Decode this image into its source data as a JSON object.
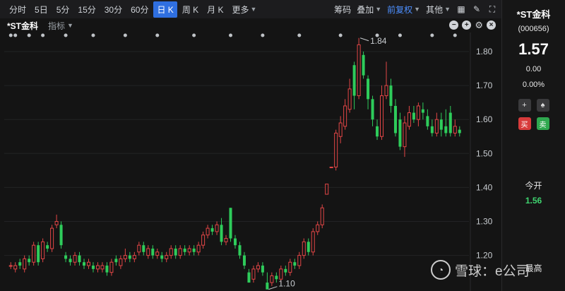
{
  "toolbar": {
    "periods": [
      "分时",
      "5日",
      "5分",
      "15分",
      "30分",
      "60分",
      "日 K",
      "周 K",
      "月 K",
      "更多"
    ],
    "active_period": "日 K",
    "right": {
      "chips": "筹码",
      "overlay": "叠加",
      "adjust": "前复权",
      "other": "其他"
    }
  },
  "chart_header": {
    "name": "*ST金科",
    "indicator": "指标"
  },
  "quote": {
    "name": "*ST金科",
    "code": "(000656)",
    "price": "1.57",
    "change": "0.00",
    "change_pct": "0.00%",
    "buy": "买",
    "sell": "卖",
    "open_label": "今开",
    "open_value": "1.56",
    "high_label": "最高"
  },
  "watermark": {
    "text": "雪球：e公司"
  },
  "colors": {
    "up": "#e24646",
    "down": "#2ecc5b",
    "active_tab": "#2f6fe0",
    "accent_text": "#4d8fff"
  },
  "chart_data": {
    "type": "candlestick",
    "y_ticks": [
      "1.80",
      "1.70",
      "1.60",
      "1.50",
      "1.40",
      "1.30",
      "1.20"
    ],
    "ylim": [
      1.1,
      1.84
    ],
    "max_label": "1.84",
    "min_label": "1.10",
    "candles": [
      [
        1.17,
        1.17,
        1.18,
        1.16
      ],
      [
        1.16,
        1.17,
        1.18,
        1.15
      ],
      [
        1.18,
        1.17,
        1.19,
        1.16
      ],
      [
        1.16,
        1.19,
        1.2,
        1.15
      ],
      [
        1.19,
        1.18,
        1.2,
        1.17
      ],
      [
        1.18,
        1.23,
        1.24,
        1.17
      ],
      [
        1.23,
        1.18,
        1.24,
        1.17
      ],
      [
        1.19,
        1.24,
        1.25,
        1.18
      ],
      [
        1.23,
        1.22,
        1.24,
        1.21
      ],
      [
        1.22,
        1.28,
        1.29,
        1.21
      ],
      [
        1.29,
        1.3,
        1.32,
        1.28
      ],
      [
        1.29,
        1.23,
        1.3,
        1.22
      ],
      [
        1.2,
        1.19,
        1.21,
        1.18
      ],
      [
        1.19,
        1.18,
        1.2,
        1.17
      ],
      [
        1.18,
        1.2,
        1.21,
        1.17
      ],
      [
        1.2,
        1.18,
        1.21,
        1.17
      ],
      [
        1.18,
        1.17,
        1.19,
        1.16
      ],
      [
        1.17,
        1.18,
        1.19,
        1.16
      ],
      [
        1.17,
        1.16,
        1.18,
        1.15
      ],
      [
        1.16,
        1.17,
        1.18,
        1.15
      ],
      [
        1.16,
        1.17,
        1.18,
        1.15
      ],
      [
        1.17,
        1.15,
        1.18,
        1.14
      ],
      [
        1.15,
        1.18,
        1.19,
        1.14
      ],
      [
        1.19,
        1.18,
        1.2,
        1.17
      ],
      [
        1.17,
        1.19,
        1.2,
        1.16
      ],
      [
        1.19,
        1.2,
        1.22,
        1.18
      ],
      [
        1.2,
        1.19,
        1.21,
        1.18
      ],
      [
        1.19,
        1.2,
        1.21,
        1.18
      ],
      [
        1.21,
        1.23,
        1.24,
        1.2
      ],
      [
        1.23,
        1.21,
        1.24,
        1.2
      ],
      [
        1.2,
        1.22,
        1.23,
        1.19
      ],
      [
        1.22,
        1.2,
        1.23,
        1.19
      ],
      [
        1.2,
        1.21,
        1.22,
        1.19
      ],
      [
        1.2,
        1.19,
        1.21,
        1.18
      ],
      [
        1.19,
        1.2,
        1.21,
        1.18
      ],
      [
        1.2,
        1.22,
        1.23,
        1.19
      ],
      [
        1.22,
        1.2,
        1.23,
        1.19
      ],
      [
        1.2,
        1.22,
        1.23,
        1.19
      ],
      [
        1.22,
        1.21,
        1.23,
        1.2
      ],
      [
        1.21,
        1.22,
        1.23,
        1.2
      ],
      [
        1.22,
        1.21,
        1.23,
        1.2
      ],
      [
        1.21,
        1.23,
        1.24,
        1.2
      ],
      [
        1.23,
        1.26,
        1.27,
        1.22
      ],
      [
        1.26,
        1.28,
        1.29,
        1.25
      ],
      [
        1.28,
        1.27,
        1.29,
        1.26
      ],
      [
        1.27,
        1.29,
        1.3,
        1.26
      ],
      [
        1.29,
        1.24,
        1.31,
        1.23
      ],
      [
        1.24,
        1.25,
        1.26,
        1.23
      ],
      [
        1.34,
        1.25,
        1.34,
        1.24
      ],
      [
        1.25,
        1.23,
        1.26,
        1.22
      ],
      [
        1.23,
        1.2,
        1.24,
        1.19
      ],
      [
        1.2,
        1.17,
        1.21,
        1.16
      ],
      [
        1.15,
        1.12,
        1.16,
        1.12
      ],
      [
        1.13,
        1.16,
        1.17,
        1.12
      ],
      [
        1.16,
        1.17,
        1.18,
        1.15
      ],
      [
        1.17,
        1.15,
        1.18,
        1.14
      ],
      [
        1.12,
        1.1,
        1.15,
        1.1
      ],
      [
        1.12,
        1.14,
        1.15,
        1.11
      ],
      [
        1.14,
        1.13,
        1.15,
        1.12
      ],
      [
        1.13,
        1.16,
        1.17,
        1.12
      ],
      [
        1.16,
        1.15,
        1.17,
        1.14
      ],
      [
        1.15,
        1.18,
        1.19,
        1.14
      ],
      [
        1.18,
        1.17,
        1.19,
        1.16
      ],
      [
        1.17,
        1.2,
        1.21,
        1.16
      ],
      [
        1.2,
        1.24,
        1.25,
        1.19
      ],
      [
        1.24,
        1.21,
        1.25,
        1.2
      ],
      [
        1.21,
        1.27,
        1.28,
        1.2
      ],
      [
        1.27,
        1.29,
        1.3,
        1.26
      ],
      [
        1.29,
        1.34,
        1.35,
        1.28
      ],
      [
        1.38,
        1.41,
        1.41,
        1.38
      ],
      [
        1.46,
        1.46,
        1.46,
        1.46
      ],
      [
        1.46,
        1.56,
        1.57,
        1.45
      ],
      [
        1.55,
        1.59,
        1.61,
        1.53
      ],
      [
        1.58,
        1.64,
        1.66,
        1.57
      ],
      [
        1.63,
        1.69,
        1.72,
        1.62
      ],
      [
        1.76,
        1.67,
        1.77,
        1.63
      ],
      [
        1.67,
        1.82,
        1.84,
        1.66
      ],
      [
        1.79,
        1.73,
        1.8,
        1.72
      ],
      [
        1.72,
        1.66,
        1.73,
        1.63
      ],
      [
        1.66,
        1.6,
        1.67,
        1.58
      ],
      [
        1.58,
        1.55,
        1.6,
        1.54
      ],
      [
        1.55,
        1.67,
        1.7,
        1.54
      ],
      [
        1.67,
        1.7,
        1.77,
        1.66
      ],
      [
        1.7,
        1.64,
        1.72,
        1.62
      ],
      [
        1.64,
        1.56,
        1.66,
        1.55
      ],
      [
        1.6,
        1.52,
        1.62,
        1.51
      ],
      [
        1.52,
        1.59,
        1.61,
        1.49
      ],
      [
        1.58,
        1.62,
        1.64,
        1.57
      ],
      [
        1.62,
        1.6,
        1.64,
        1.59
      ],
      [
        1.6,
        1.64,
        1.65,
        1.58
      ],
      [
        1.63,
        1.62,
        1.65,
        1.6
      ],
      [
        1.61,
        1.58,
        1.63,
        1.57
      ],
      [
        1.58,
        1.56,
        1.6,
        1.55
      ],
      [
        1.56,
        1.6,
        1.62,
        1.55
      ],
      [
        1.6,
        1.57,
        1.62,
        1.55
      ],
      [
        1.58,
        1.56,
        1.63,
        1.55
      ],
      [
        1.62,
        1.56,
        1.64,
        1.55
      ],
      [
        1.56,
        1.58,
        1.6,
        1.55
      ],
      [
        1.57,
        1.56,
        1.58,
        1.55
      ]
    ],
    "event_marker_indices": [
      0,
      1,
      4,
      7,
      12,
      18,
      25,
      32,
      40,
      48,
      55,
      63,
      72,
      80,
      85,
      92,
      97
    ]
  }
}
